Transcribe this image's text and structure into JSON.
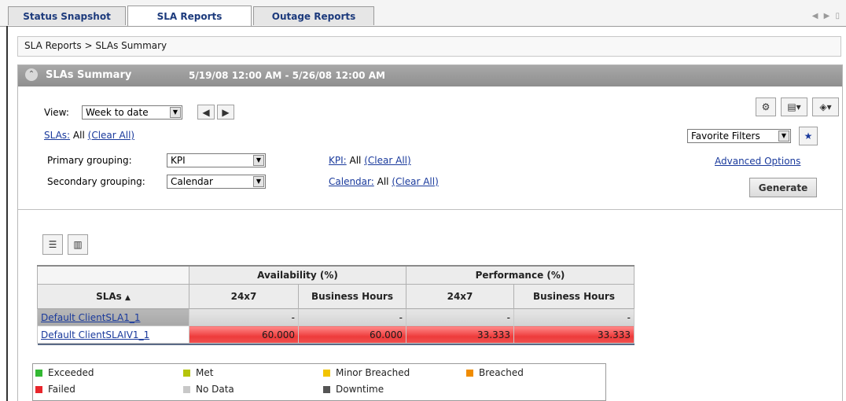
{
  "tabs": [
    {
      "label": "Status Snapshot"
    },
    {
      "label": "SLA Reports"
    },
    {
      "label": "Outage Reports"
    }
  ],
  "breadcrumb": "SLA Reports > SLAs Summary",
  "panel": {
    "title": "SLAs Summary",
    "date_range": "5/19/08 12:00 AM - 5/26/08 12:00 AM"
  },
  "filters": {
    "view_label": "View:",
    "view_value": "Week to date",
    "slas_link": "SLAs:",
    "slas_value": "All",
    "clear_all": "(Clear All)",
    "primary_label": "Primary grouping:",
    "primary_value": "KPI",
    "secondary_label": "Secondary grouping:",
    "secondary_value": "Calendar",
    "kpi_link": "KPI:",
    "kpi_value": "All",
    "calendar_link": "Calendar:",
    "calendar_value": "All"
  },
  "right_controls": {
    "favorite_filters": "Favorite Filters",
    "advanced_options": "Advanced Options",
    "generate": "Generate"
  },
  "table": {
    "group_headers": [
      "Availability (%)",
      "Performance (%)"
    ],
    "sla_header": "SLAs",
    "sub_headers": [
      "24x7",
      "Business Hours",
      "24x7",
      "Business Hours"
    ],
    "rows": [
      {
        "sla": "Default ClientSLA1_1",
        "status": "no-data",
        "values": [
          "-",
          "-",
          "-",
          "-"
        ]
      },
      {
        "sla": "Default ClientSLAIV1_1",
        "status": "failed",
        "values": [
          "60.000",
          "60.000",
          "33.333",
          "33.333"
        ]
      }
    ]
  },
  "legend": [
    {
      "label": "Exceeded",
      "color": "#33b833"
    },
    {
      "label": "Met",
      "color": "#b5c40a"
    },
    {
      "label": "Minor Breached",
      "color": "#f2c400"
    },
    {
      "label": "Breached",
      "color": "#f08c00"
    },
    {
      "label": "Failed",
      "color": "#e8262c"
    },
    {
      "label": "No Data",
      "color": "#c8c8c8"
    },
    {
      "label": "Downtime",
      "color": "#555555"
    }
  ]
}
